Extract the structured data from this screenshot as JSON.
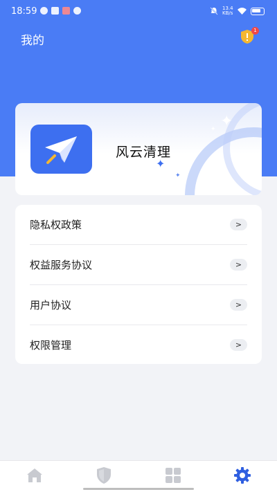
{
  "status_bar": {
    "time": "18:59",
    "network_speed": "13.4 KB/s"
  },
  "header": {
    "title": "我的",
    "notification_count": "1"
  },
  "app_card": {
    "app_name": "风云清理"
  },
  "menu": {
    "items": [
      {
        "label": "隐私权政策",
        "chevron": ">"
      },
      {
        "label": "权益服务协议",
        "chevron": ">"
      },
      {
        "label": "用户协议",
        "chevron": ">"
      },
      {
        "label": "权限管理",
        "chevron": ">"
      }
    ]
  },
  "tab_bar": {
    "tabs": [
      {
        "icon": "home-icon"
      },
      {
        "icon": "shield-icon"
      },
      {
        "icon": "grid-icon"
      },
      {
        "icon": "gear-icon",
        "active": true
      }
    ]
  },
  "colors": {
    "primary": "#4a7cf5",
    "logo_bg": "#3d6ff0",
    "tab_inactive": "#c8cad0",
    "tab_active": "#2f5fe0",
    "badge_red": "#f04848",
    "badge_gold": "#f5b731"
  }
}
